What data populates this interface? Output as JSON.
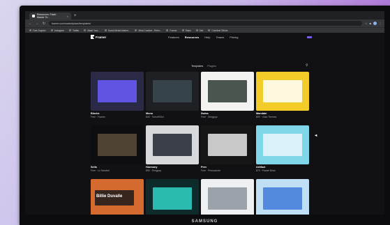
{
  "browser": {
    "tab_title": "Resources: Flash: Master Te...",
    "tab_close": "×",
    "new_tab": "+",
    "url": "framer.com/marketplace/templates/",
    "bookmarks": [
      "Fast Grapher",
      "Instagram",
      "Twitter",
      "Make Your...",
      "Social Media Market...",
      "Meta Creative - Refer...",
      "Framer",
      "Stack",
      "Diet",
      "Codefest Github"
    ]
  },
  "nav": {
    "logo": "Framer",
    "links": [
      "Features",
      "Resources",
      "Help",
      "Teams",
      "Pricing"
    ],
    "active_link": "Resources"
  },
  "subtabs": [
    "Templates",
    "Plugins"
  ],
  "active_subtab": "Templates",
  "icons": {
    "back": "arrow-left-icon",
    "forward": "arrow-right-icon",
    "reload": "reload-icon",
    "search": "search-icon"
  },
  "cards": [
    {
      "name": "Blocks",
      "price": "Free · Framer",
      "bg": "#2a2a46",
      "accent": "#6a5cff"
    },
    {
      "name": "Mono",
      "price": "$49 · Tomoffi Bot",
      "bg": "#1e2024",
      "accent": "#3c4a52"
    },
    {
      "name": "Swiss",
      "price": "Free · Shrigpop",
      "bg": "#f2f2f0",
      "accent": "#2d3a34"
    },
    {
      "name": "Mandate",
      "price": "$99 · Voka Themes",
      "bg": "#f4cc2a",
      "accent": "#ffffff"
    },
    {
      "name": "Sells",
      "price": "Free · Lo Sanchel",
      "bg": "#0e0e10",
      "accent": "#5a4c3a"
    },
    {
      "name": "Harmony",
      "price": "$99 · Shrigpop",
      "bg": "#d6d8dc",
      "accent": "#1f2530"
    },
    {
      "name": "Prev",
      "price": "Free · Premadocie",
      "bg": "#161616",
      "accent": "#e8e8e8"
    },
    {
      "name": "Artifact",
      "price": "$79 · Prawel Birds",
      "bg": "#7fd6e8",
      "accent": "#e9f6fa"
    },
    {
      "name": "Billie Duvalle",
      "price": "",
      "bg": "#d46a2e",
      "accent": "#ffffff"
    },
    {
      "name": "",
      "price": "",
      "bg": "#0f2a2a",
      "accent": "#2fd3c6"
    },
    {
      "name": "",
      "price": "",
      "bg": "#eef0f2",
      "accent": "#8c949c"
    },
    {
      "name": "",
      "price": "",
      "bg": "#bfe0f4",
      "accent": "#3f7ad8"
    }
  ],
  "thumb_texts": {
    "card0": "",
    "card2": "",
    "card3": "",
    "card4": "",
    "card8": "Billie Duvalle"
  },
  "monitor_brand": "SAMSUNG"
}
